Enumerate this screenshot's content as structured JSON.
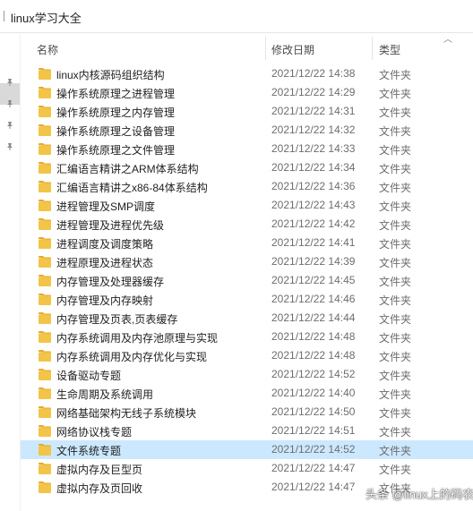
{
  "window": {
    "address": "linux学习大全"
  },
  "columns": {
    "name": "名称",
    "date": "修改日期",
    "type": "类型"
  },
  "icons": {
    "folder": "folder-icon",
    "pin": "pin-icon",
    "sort": "sort-up-icon"
  },
  "colors": {
    "folder": "#f2c447",
    "folder_tab": "#e6a92a",
    "selection": "#cce8ff"
  },
  "files": [
    {
      "name": "linux内核源码组织结构",
      "date": "2021/12/22 14:38",
      "type": "文件夹"
    },
    {
      "name": "操作系统原理之进程管理",
      "date": "2021/12/22 14:29",
      "type": "文件夹"
    },
    {
      "name": "操作系统原理之内存管理",
      "date": "2021/12/22 14:31",
      "type": "文件夹"
    },
    {
      "name": "操作系统原理之设备管理",
      "date": "2021/12/22 14:32",
      "type": "文件夹"
    },
    {
      "name": "操作系统原理之文件管理",
      "date": "2021/12/22 14:33",
      "type": "文件夹"
    },
    {
      "name": "汇编语言精讲之ARM体系结构",
      "date": "2021/12/22 14:34",
      "type": "文件夹"
    },
    {
      "name": "汇编语言精讲之x86-84体系结构",
      "date": "2021/12/22 14:36",
      "type": "文件夹"
    },
    {
      "name": "进程管理及SMP调度",
      "date": "2021/12/22 14:43",
      "type": "文件夹"
    },
    {
      "name": "进程管理及进程优先级",
      "date": "2021/12/22 14:42",
      "type": "文件夹"
    },
    {
      "name": "进程调度及调度策略",
      "date": "2021/12/22 14:41",
      "type": "文件夹"
    },
    {
      "name": "进程原理及进程状态",
      "date": "2021/12/22 14:39",
      "type": "文件夹"
    },
    {
      "name": "内存管理及处理器缓存",
      "date": "2021/12/22 14:45",
      "type": "文件夹"
    },
    {
      "name": "内存管理及内存映射",
      "date": "2021/12/22 14:46",
      "type": "文件夹"
    },
    {
      "name": "内存管理及页表,页表缓存",
      "date": "2021/12/22 14:44",
      "type": "文件夹"
    },
    {
      "name": "内存系统调用及内存池原理与实现",
      "date": "2021/12/22 14:48",
      "type": "文件夹"
    },
    {
      "name": "内存系统调用及内存优化与实现",
      "date": "2021/12/22 14:48",
      "type": "文件夹"
    },
    {
      "name": "设备驱动专题",
      "date": "2021/12/22 14:52",
      "type": "文件夹"
    },
    {
      "name": "生命周期及系统调用",
      "date": "2021/12/22 14:40",
      "type": "文件夹"
    },
    {
      "name": "网络基础架构无线子系统模块",
      "date": "2021/12/22 14:50",
      "type": "文件夹"
    },
    {
      "name": "网络协议栈专题",
      "date": "2021/12/22 14:51",
      "type": "文件夹"
    },
    {
      "name": "文件系统专题",
      "date": "2021/12/22 14:52",
      "type": "文件夹",
      "selected": true
    },
    {
      "name": "虚拟内存及巨型页",
      "date": "2021/12/22 14:47",
      "type": "文件夹"
    },
    {
      "name": "虚拟内存及页回收",
      "date": "2021/12/22 14:47",
      "type": "文件夹"
    }
  ],
  "watermark": {
    "text": "头条 @linux上的码农",
    "logo": "toutiao-logo-icon"
  }
}
